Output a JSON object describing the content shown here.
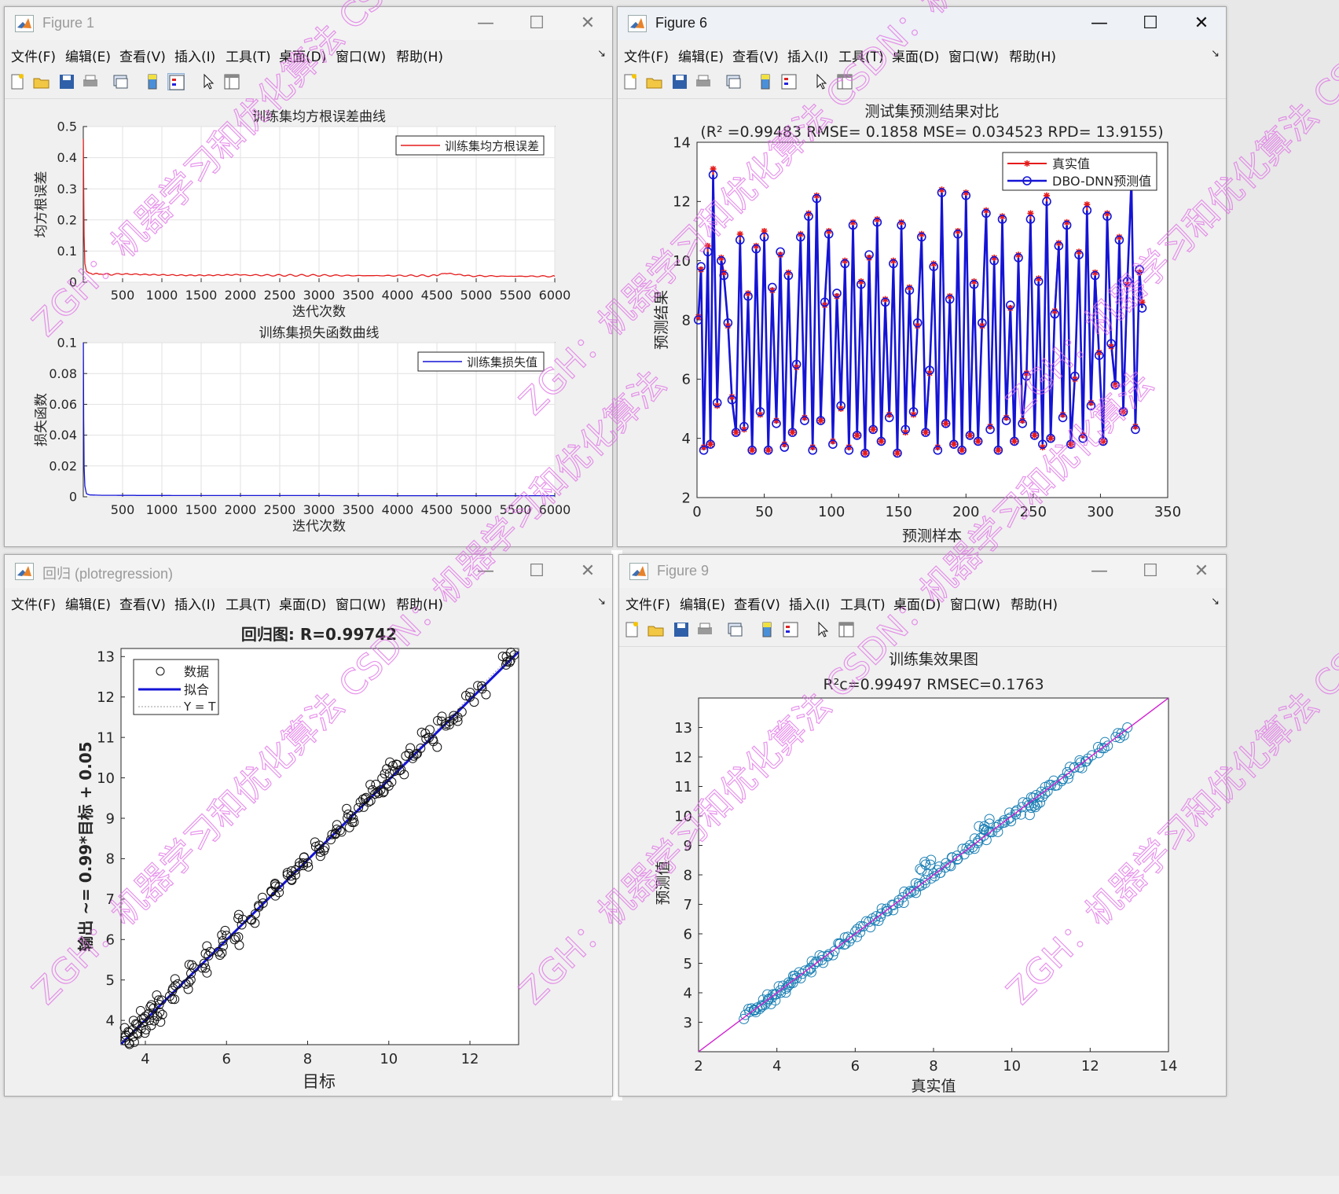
{
  "menus": [
    "文件(F)",
    "编辑(E)",
    "查看(V)",
    "插入(I)",
    "工具(T)",
    "桌面(D)",
    "窗口(W)",
    "帮助(H)"
  ],
  "window_controls": {
    "minimize": "—",
    "maximize": "☐",
    "close": "✕"
  },
  "colors": {
    "red": "#e51b1b",
    "blue": "#1414d6",
    "teal": "#1a7fb4",
    "magenta": "#d020d0",
    "watermark": "#e070e6"
  },
  "watermark_text": "ZGH：机器学习和优化算法 CSDN：机器学习和优化算法",
  "windows": {
    "fig1": {
      "title": "Figure 1"
    },
    "fig6": {
      "title": "Figure 6"
    },
    "reg": {
      "title": "回归 (plotregression)"
    },
    "fig9": {
      "title": "Figure 9"
    }
  },
  "chart_data": [
    {
      "id": "rmse",
      "type": "line",
      "title": "训练集均方根误差曲线",
      "xlabel": "迭代次数",
      "ylabel": "均方根误差",
      "xlim": [
        0,
        6000
      ],
      "ylim": [
        0,
        0.5
      ],
      "xticks": [
        500,
        1000,
        1500,
        2000,
        2500,
        3000,
        3500,
        4000,
        4500,
        5000,
        5500,
        6000
      ],
      "yticks": [
        0,
        0.1,
        0.2,
        0.3,
        0.4,
        0.5
      ],
      "grid": true,
      "legend_position": "top-right",
      "series": [
        {
          "name": "训练集均方根误差",
          "color": "#e51b1b",
          "x": [
            1,
            10,
            20,
            40,
            70,
            100,
            200,
            400,
            800,
            1200,
            1600,
            2000,
            2500,
            3000,
            3500,
            4000,
            4500,
            4600,
            5000,
            5500,
            6000
          ],
          "y": [
            0.46,
            0.15,
            0.06,
            0.035,
            0.03,
            0.028,
            0.026,
            0.025,
            0.024,
            0.024,
            0.023,
            0.023,
            0.022,
            0.022,
            0.021,
            0.021,
            0.021,
            0.03,
            0.02,
            0.019,
            0.019
          ]
        }
      ]
    },
    {
      "id": "loss",
      "type": "line",
      "title": "训练集损失函数曲线",
      "xlabel": "迭代次数",
      "ylabel": "损失函数",
      "xlim": [
        0,
        6000
      ],
      "ylim": [
        0,
        0.1
      ],
      "xticks": [
        500,
        1000,
        1500,
        2000,
        2500,
        3000,
        3500,
        4000,
        4500,
        5000,
        5500,
        6000
      ],
      "yticks": [
        0,
        0.02,
        0.04,
        0.06,
        0.08,
        0.1
      ],
      "grid": true,
      "legend_position": "top-right",
      "series": [
        {
          "name": "训练集损失值",
          "color": "#1414d6",
          "x": [
            1,
            5,
            10,
            20,
            40,
            80,
            200,
            600,
            1500,
            3000,
            4500,
            6000
          ],
          "y": [
            0.1,
            0.05,
            0.02,
            0.007,
            0.002,
            0.0012,
            0.001,
            0.0009,
            0.0008,
            0.0008,
            0.0007,
            0.0007
          ]
        }
      ]
    },
    {
      "id": "test",
      "type": "line",
      "title": "测试集预测结果对比",
      "subtitle": "(R² =0.99483 RMSE= 0.1858 MSE= 0.034523 RPD= 13.9155)",
      "xlabel": "预测样本",
      "ylabel": "预测结果",
      "xlim": [
        0,
        350
      ],
      "ylim": [
        2,
        14
      ],
      "xticks": [
        0,
        50,
        100,
        150,
        200,
        250,
        300,
        350
      ],
      "yticks": [
        2,
        4,
        6,
        8,
        10,
        12,
        14
      ],
      "grid": false,
      "legend_position": "top-right",
      "series": [
        {
          "name": "真实值",
          "color": "#e51b1b",
          "marker": "asterisk",
          "x": [
            1,
            3,
            5,
            8,
            10,
            12,
            15,
            18,
            20,
            23,
            26,
            29,
            32,
            35,
            38,
            41,
            44,
            47,
            50,
            53,
            56,
            59,
            62,
            65,
            68,
            71,
            74,
            77,
            80,
            83,
            86,
            89,
            92,
            95,
            98,
            101,
            104,
            107,
            110,
            113,
            116,
            119,
            122,
            125,
            128,
            131,
            134,
            137,
            140,
            143,
            146,
            149,
            152,
            155,
            158,
            161,
            164,
            167,
            170,
            173,
            176,
            179,
            182,
            185,
            188,
            191,
            194,
            197,
            200,
            203,
            206,
            209,
            212,
            215,
            218,
            221,
            224,
            227,
            230,
            233,
            236,
            239,
            242,
            245,
            248,
            251,
            254,
            257,
            260,
            263,
            266,
            269,
            272,
            275,
            278,
            281,
            284,
            287,
            290,
            293,
            296,
            299,
            302,
            305,
            308,
            311,
            314,
            317,
            320,
            323,
            326,
            329,
            331
          ],
          "y": [
            8.1,
            9.7,
            3.7,
            10.5,
            3.8,
            13.1,
            5.1,
            10.1,
            9.6,
            7.8,
            5.4,
            4.2,
            10.9,
            4.3,
            8.9,
            3.6,
            10.5,
            4.8,
            11.0,
            3.6,
            9.0,
            4.6,
            10.2,
            3.8,
            9.6,
            4.2,
            6.4,
            10.9,
            4.7,
            11.6,
            3.7,
            12.2,
            4.6,
            8.5,
            11.0,
            3.9,
            8.8,
            5.0,
            10.0,
            3.7,
            11.3,
            4.1,
            9.3,
            3.5,
            10.1,
            4.3,
            11.4,
            3.9,
            8.7,
            4.8,
            10.0,
            3.5,
            11.3,
            4.2,
            9.1,
            4.8,
            7.8,
            10.9,
            4.2,
            6.2,
            9.9,
            3.7,
            12.4,
            4.5,
            8.8,
            3.8,
            11.0,
            3.6,
            12.3,
            4.1,
            9.3,
            3.9,
            7.8,
            11.7,
            4.4,
            10.1,
            3.6,
            11.5,
            4.7,
            8.4,
            3.9,
            10.2,
            4.6,
            6.2,
            11.6,
            4.1,
            9.4,
            3.7,
            12.2,
            4.0,
            8.3,
            10.6,
            4.8,
            11.3,
            3.8,
            6.0,
            10.3,
            4.1,
            11.9,
            5.2,
            9.6,
            6.9,
            3.9,
            11.6,
            7.1,
            5.8,
            10.8,
            4.9,
            9.2,
            12.9,
            4.4,
            9.6,
            8.6
          ]
        },
        {
          "name": "DBO-DNN预测值",
          "color": "#1414d6",
          "marker": "circle",
          "x": [
            1,
            3,
            5,
            8,
            10,
            12,
            15,
            18,
            20,
            23,
            26,
            29,
            32,
            35,
            38,
            41,
            44,
            47,
            50,
            53,
            56,
            59,
            62,
            65,
            68,
            71,
            74,
            77,
            80,
            83,
            86,
            89,
            92,
            95,
            98,
            101,
            104,
            107,
            110,
            113,
            116,
            119,
            122,
            125,
            128,
            131,
            134,
            137,
            140,
            143,
            146,
            149,
            152,
            155,
            158,
            161,
            164,
            167,
            170,
            173,
            176,
            179,
            182,
            185,
            188,
            191,
            194,
            197,
            200,
            203,
            206,
            209,
            212,
            215,
            218,
            221,
            224,
            227,
            230,
            233,
            236,
            239,
            242,
            245,
            248,
            251,
            254,
            257,
            260,
            263,
            266,
            269,
            272,
            275,
            278,
            281,
            284,
            287,
            290,
            293,
            296,
            299,
            302,
            305,
            308,
            311,
            314,
            317,
            320,
            323,
            326,
            329,
            331
          ],
          "y": [
            8.0,
            9.8,
            3.6,
            10.3,
            3.8,
            12.9,
            5.2,
            10.0,
            9.5,
            7.9,
            5.3,
            4.2,
            10.7,
            4.4,
            8.8,
            3.6,
            10.4,
            4.9,
            10.8,
            3.6,
            9.1,
            4.5,
            10.3,
            3.7,
            9.5,
            4.2,
            6.5,
            10.8,
            4.6,
            11.5,
            3.6,
            12.1,
            4.6,
            8.6,
            10.9,
            3.8,
            8.9,
            5.1,
            9.9,
            3.6,
            11.2,
            4.1,
            9.2,
            3.5,
            10.2,
            4.3,
            11.3,
            3.9,
            8.6,
            4.7,
            9.9,
            3.5,
            11.2,
            4.3,
            9.0,
            4.9,
            7.9,
            10.8,
            4.2,
            6.3,
            9.8,
            3.6,
            12.3,
            4.5,
            8.7,
            3.8,
            10.9,
            3.6,
            12.2,
            4.1,
            9.2,
            3.9,
            7.9,
            11.6,
            4.3,
            10.0,
            3.6,
            11.4,
            4.6,
            8.5,
            3.9,
            10.1,
            4.5,
            6.1,
            11.4,
            4.1,
            9.3,
            3.8,
            12.0,
            4.0,
            8.2,
            10.5,
            4.7,
            11.2,
            3.8,
            6.1,
            10.2,
            4.0,
            11.7,
            5.1,
            9.5,
            6.8,
            3.9,
            11.5,
            7.2,
            5.8,
            10.7,
            4.9,
            9.3,
            12.7,
            4.3,
            9.7,
            8.4
          ]
        }
      ]
    },
    {
      "id": "regression",
      "type": "scatter",
      "title": "回归图: R=0.99742",
      "xlabel": "目标",
      "ylabel": "输出 ~= 0.99*目标 + 0.05",
      "xlim": [
        3.4,
        13.2
      ],
      "ylim": [
        3.4,
        13.2
      ],
      "xticks": [
        4,
        6,
        8,
        10,
        12
      ],
      "yticks": [
        4,
        5,
        6,
        7,
        8,
        9,
        10,
        11,
        12,
        13
      ],
      "grid": false,
      "legend_position": "top-left",
      "fit": {
        "slope": 0.99,
        "intercept": 0.05
      },
      "series": [
        {
          "name": "数据",
          "color": "#111111",
          "marker": "circle",
          "x": [
            3.5,
            3.6,
            3.7,
            3.8,
            3.9,
            4.0,
            4.1,
            4.2,
            4.3,
            4.4,
            4.6,
            4.8,
            5.0,
            5.2,
            5.4,
            5.6,
            5.8,
            6.0,
            6.2,
            6.4,
            6.6,
            6.9,
            7.1,
            7.3,
            7.5,
            7.7,
            7.8,
            8.0,
            8.2,
            8.4,
            8.6,
            8.8,
            9.0,
            9.1,
            9.3,
            9.5,
            9.6,
            9.8,
            9.9,
            10.0,
            10.1,
            10.3,
            10.5,
            10.7,
            10.9,
            11.1,
            11.3,
            11.5,
            11.7,
            12.0,
            12.3,
            12.9,
            13.0
          ],
          "y": [
            3.5,
            3.7,
            3.6,
            3.9,
            3.8,
            4.1,
            4.0,
            4.3,
            4.1,
            4.5,
            4.6,
            4.9,
            4.9,
            5.3,
            5.3,
            5.7,
            5.7,
            6.1,
            6.0,
            6.5,
            6.5,
            6.9,
            7.2,
            7.3,
            7.6,
            7.6,
            7.9,
            7.9,
            8.3,
            8.2,
            8.6,
            8.7,
            9.1,
            8.9,
            9.4,
            9.4,
            9.7,
            9.7,
            10.1,
            9.8,
            10.3,
            10.2,
            10.6,
            10.6,
            11.1,
            10.9,
            11.4,
            11.4,
            11.5,
            12.0,
            12.2,
            13.0,
            12.9
          ]
        },
        {
          "name": "拟合",
          "color": "#1414d6"
        },
        {
          "name": "Y = T",
          "color": "#999999"
        }
      ]
    },
    {
      "id": "train",
      "type": "scatter",
      "title": "训练集效果图",
      "subtitle": "R²c=0.99497  RMSEC=0.1763",
      "xlabel": "真实值",
      "ylabel": "预测值",
      "xlim": [
        2,
        14
      ],
      "ylim": [
        2,
        14
      ],
      "xticks": [
        2,
        4,
        6,
        8,
        10,
        12,
        14
      ],
      "yticks": [
        3,
        4,
        5,
        6,
        7,
        8,
        9,
        10,
        11,
        12,
        13
      ],
      "grid": false,
      "series": [
        {
          "name": "训练集",
          "color": "#1a7fb4",
          "marker": "circle",
          "x": [
            3.3,
            3.5,
            3.7,
            3.9,
            4.1,
            4.3,
            4.5,
            4.8,
            5.0,
            5.3,
            5.6,
            5.9,
            6.2,
            6.5,
            6.8,
            7.1,
            7.4,
            7.7,
            8.0,
            8.3,
            8.6,
            8.9,
            9.2,
            9.5,
            9.8,
            10.1,
            10.4,
            10.7,
            11.0,
            11.3,
            11.6,
            11.9,
            12.3,
            12.8,
            7.8,
            9.3,
            10.6
          ],
          "y": [
            3.35,
            3.5,
            3.6,
            3.95,
            4.0,
            4.35,
            4.5,
            4.75,
            5.05,
            5.25,
            5.65,
            5.85,
            6.25,
            6.45,
            6.85,
            7.05,
            7.45,
            7.65,
            8.05,
            8.25,
            8.65,
            8.85,
            9.25,
            9.45,
            9.85,
            10.05,
            10.45,
            10.65,
            11.05,
            11.25,
            11.65,
            11.85,
            12.3,
            12.8,
            8.35,
            9.65,
            10.3
          ]
        },
        {
          "name": "Y = T",
          "color": "#d020d0"
        }
      ]
    }
  ]
}
